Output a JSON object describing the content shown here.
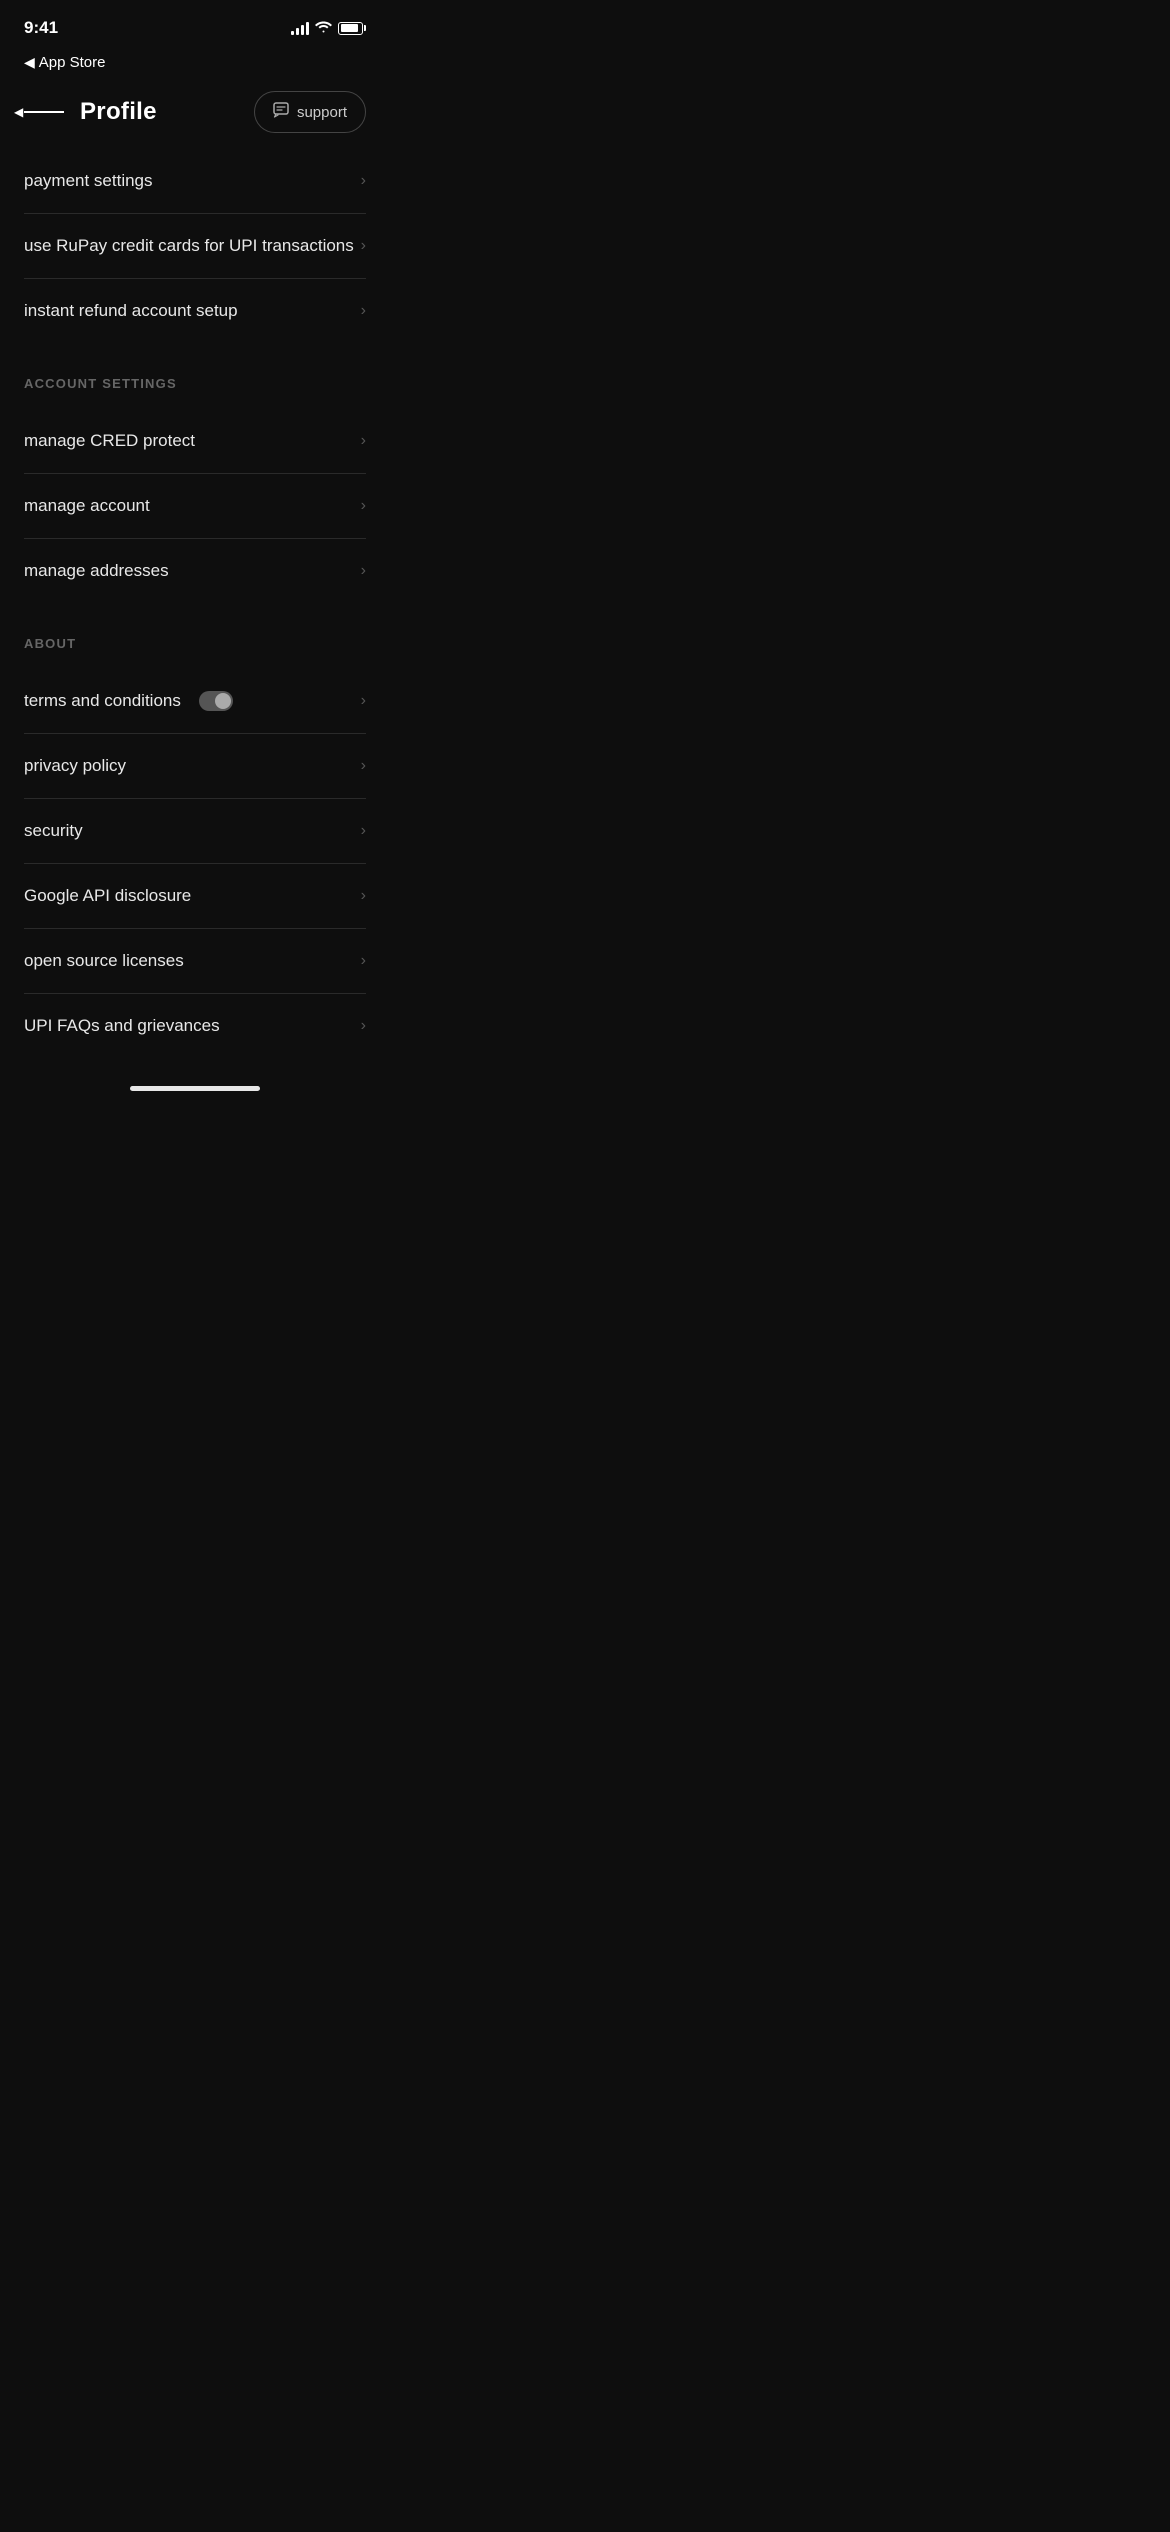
{
  "statusBar": {
    "time": "9:41",
    "appStoreBack": "App Store"
  },
  "header": {
    "title": "Profile",
    "supportLabel": "support"
  },
  "paymentSection": {
    "items": [
      {
        "id": "payment-settings",
        "label": "payment settings"
      },
      {
        "id": "rupay-credit",
        "label": "use RuPay credit cards for UPI transactions"
      },
      {
        "id": "instant-refund",
        "label": "instant refund account setup"
      }
    ]
  },
  "accountSection": {
    "title": "ACCOUNT SETTINGS",
    "items": [
      {
        "id": "cred-protect",
        "label": "manage CRED protect"
      },
      {
        "id": "manage-account",
        "label": "manage account"
      },
      {
        "id": "manage-addresses",
        "label": "manage addresses"
      }
    ]
  },
  "aboutSection": {
    "title": "ABOUT",
    "items": [
      {
        "id": "terms",
        "label": "terms and conditions",
        "hasToggle": true
      },
      {
        "id": "privacy",
        "label": "privacy policy",
        "hasToggle": false
      },
      {
        "id": "security",
        "label": "security",
        "hasToggle": false
      },
      {
        "id": "google-api",
        "label": "Google API disclosure",
        "hasToggle": false
      },
      {
        "id": "open-source",
        "label": "open source licenses",
        "hasToggle": false
      },
      {
        "id": "upi-faqs",
        "label": "UPI FAQs and grievances",
        "hasToggle": false
      }
    ]
  }
}
